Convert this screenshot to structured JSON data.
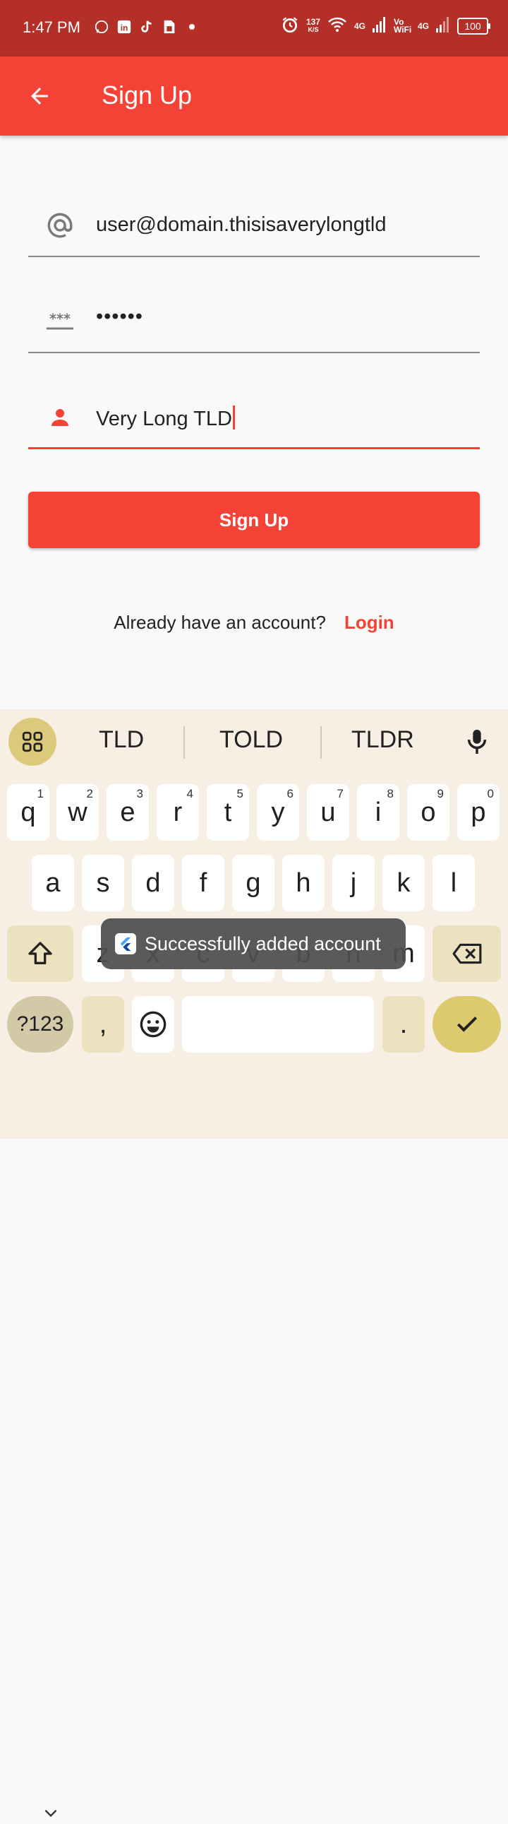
{
  "status_bar": {
    "time": "1:47 PM",
    "left_icons": [
      "whatsapp-icon",
      "linkedin-icon",
      "tiktok-icon",
      "sim-icon",
      "dot-icon"
    ],
    "net_speed_value": "137",
    "net_speed_unit": "K/S",
    "signal1_label": "4G",
    "vowifi_label": "Vo WiFi",
    "signal2_label": "4G",
    "battery": "100"
  },
  "appbar": {
    "title": "Sign Up",
    "back_icon": "arrow-back-icon"
  },
  "form": {
    "email": {
      "icon": "at-icon",
      "value": "user@domain.thisisaverylongtld"
    },
    "password": {
      "icon": "password-icon",
      "value": "••••••"
    },
    "name": {
      "icon": "person-icon",
      "value": "Very Long TLD"
    }
  },
  "signup_button": {
    "label": "Sign Up"
  },
  "login_prompt": {
    "question": "Already have an account?",
    "link": "Login"
  },
  "keyboard": {
    "suggestions": [
      "TLD",
      "TOLD",
      "TLDR"
    ],
    "row1": [
      {
        "key": "q",
        "hint": "1"
      },
      {
        "key": "w",
        "hint": "2"
      },
      {
        "key": "e",
        "hint": "3"
      },
      {
        "key": "r",
        "hint": "4"
      },
      {
        "key": "t",
        "hint": "5"
      },
      {
        "key": "y",
        "hint": "6"
      },
      {
        "key": "u",
        "hint": "7"
      },
      {
        "key": "i",
        "hint": "8"
      },
      {
        "key": "o",
        "hint": "9"
      },
      {
        "key": "p",
        "hint": "0"
      }
    ],
    "row2": [
      "a",
      "s",
      "d",
      "f",
      "g",
      "h",
      "j",
      "k",
      "l"
    ],
    "row3": [
      "z",
      "x",
      "c",
      "v",
      "b",
      "n",
      "m"
    ],
    "sym_label": "?123",
    "comma": ",",
    "period": "."
  },
  "toast": {
    "text": "Successfully added account"
  },
  "colors": {
    "primary": "#f44336",
    "status_bar": "#b32f28",
    "keyboard_bg": "#f7efe4"
  }
}
